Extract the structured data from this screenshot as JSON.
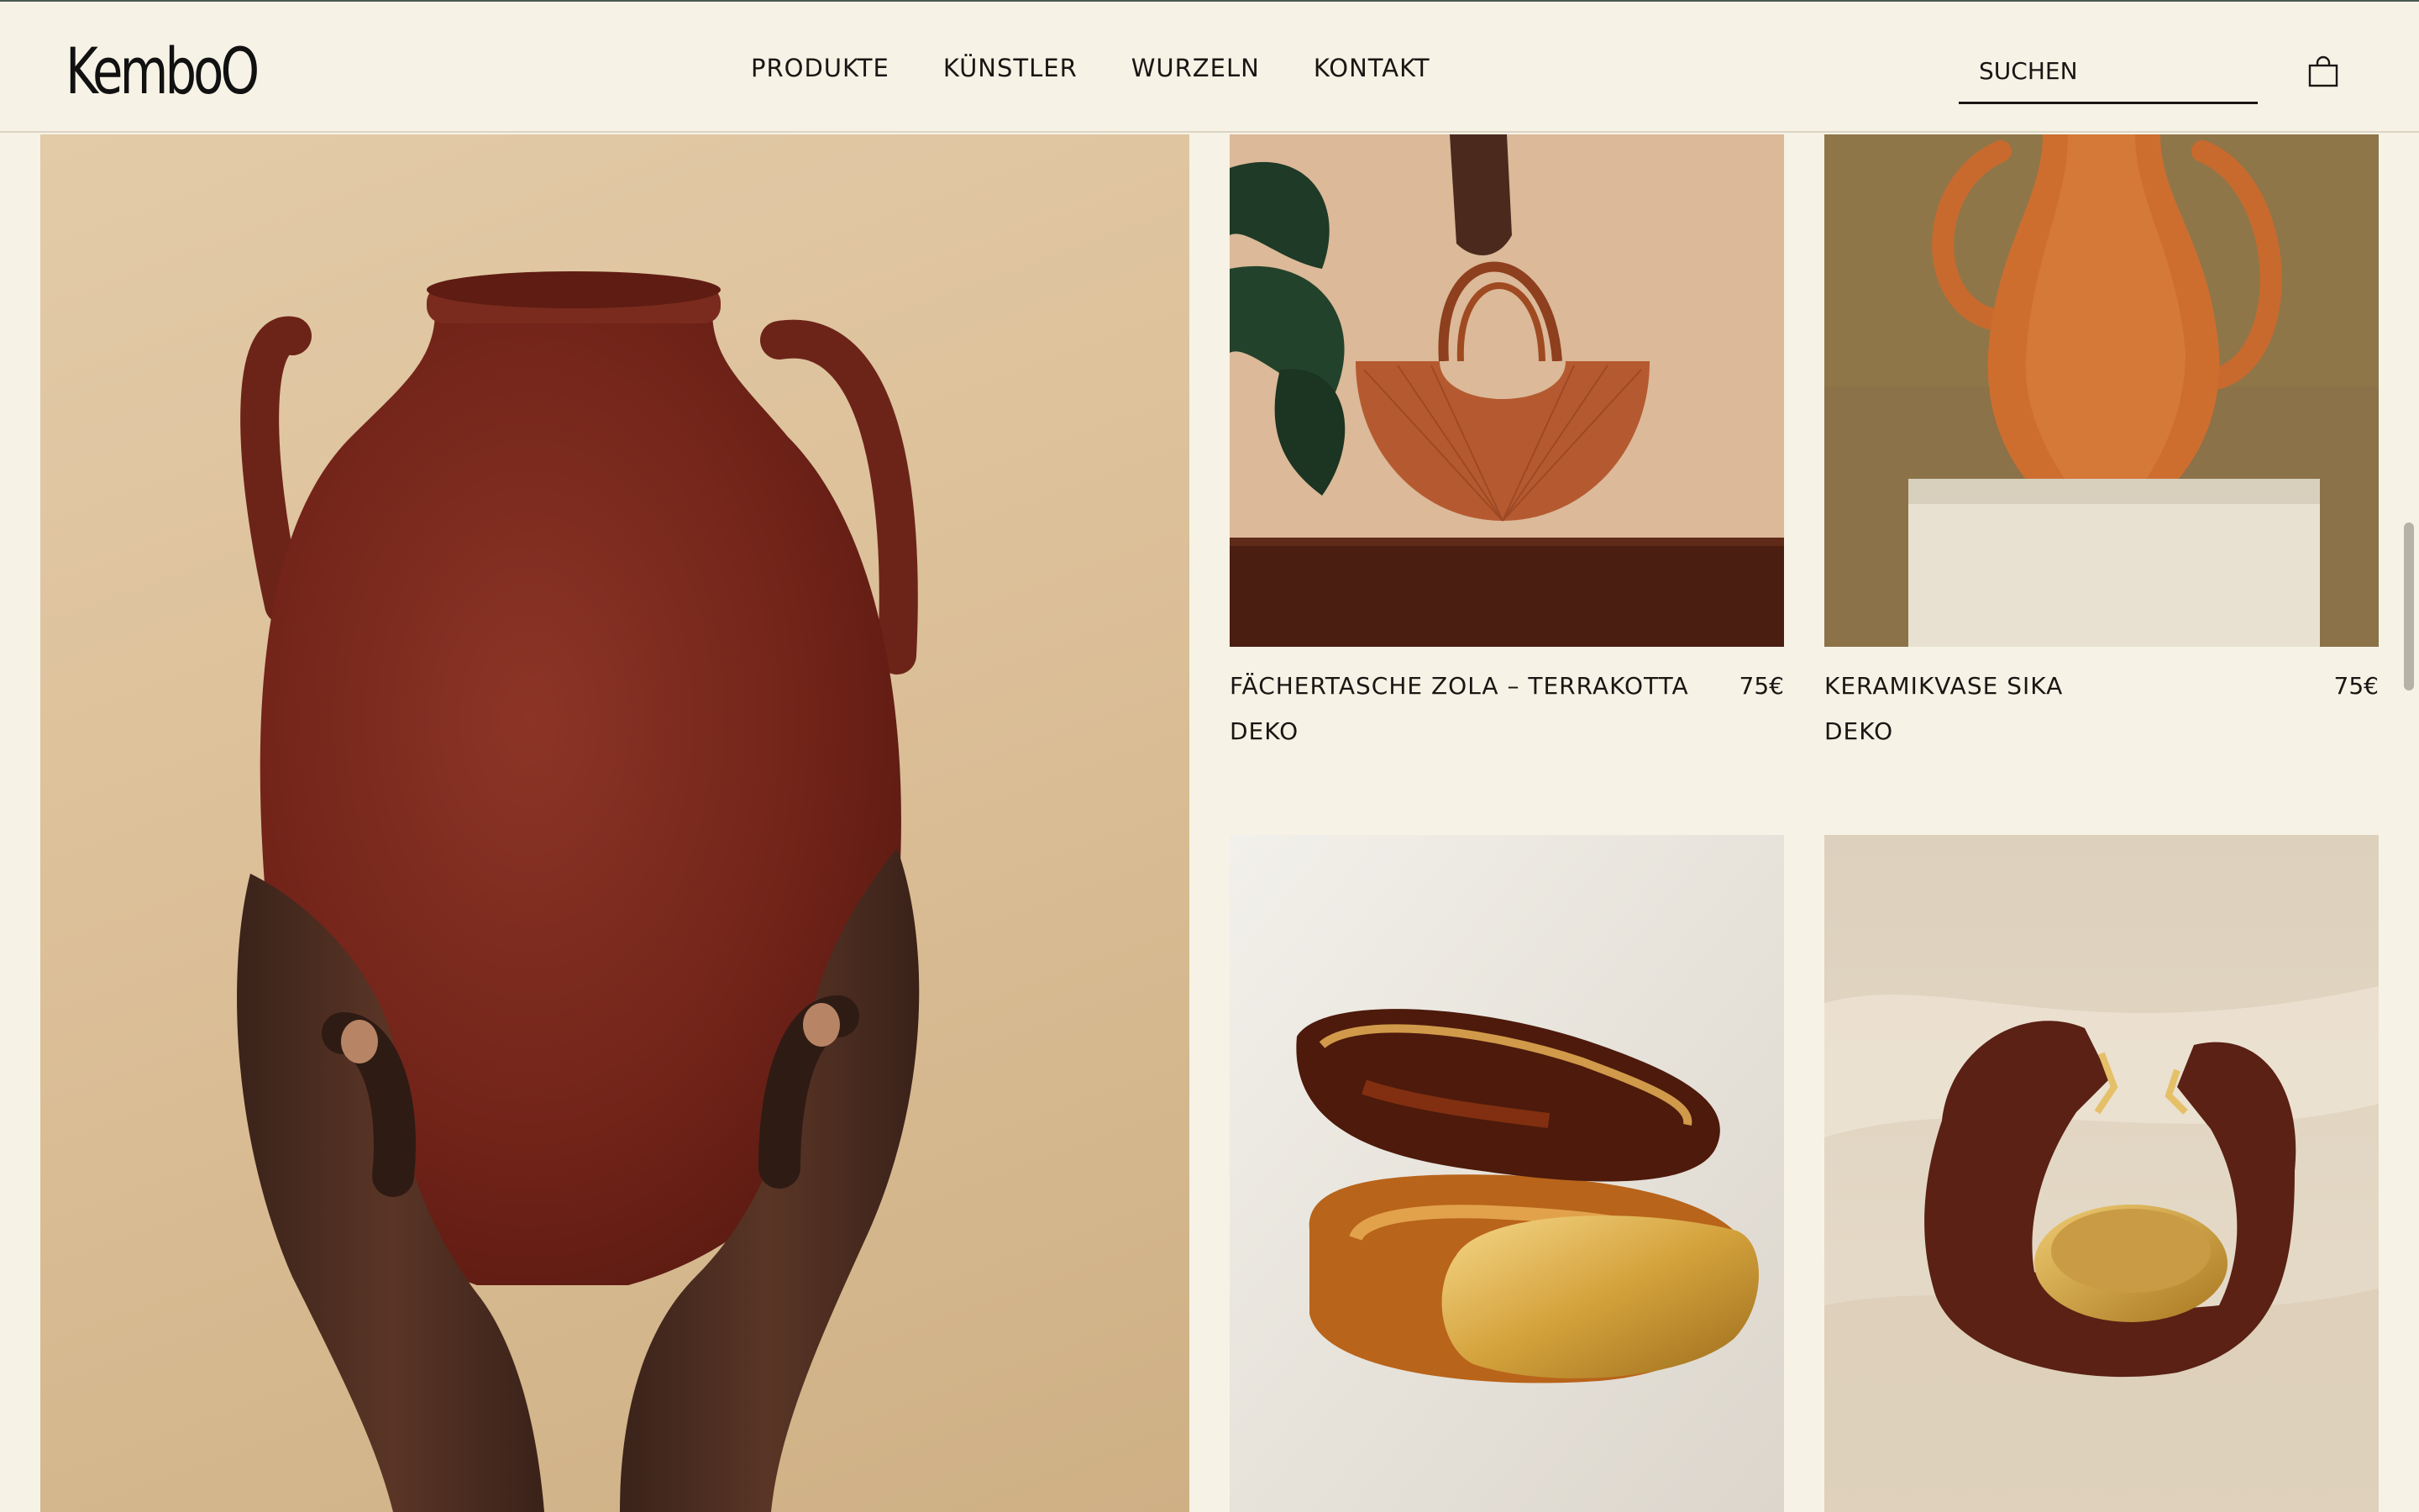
{
  "brand": {
    "logo_text": "KembοO"
  },
  "nav": {
    "items": [
      "PRODUKTE",
      "KÜNSTLER",
      "WURZELN",
      "KONTAKT"
    ]
  },
  "search": {
    "placeholder": "SUCHEN"
  },
  "icons": {
    "cart": "shopping-bag-icon"
  },
  "colors": {
    "background": "#f6f2e6",
    "text": "#1a1613",
    "terracotta": "#b55a30",
    "vase_red": "#7c2a1f"
  },
  "hero": {
    "image": "hands-holding-red-clay-vase"
  },
  "products": [
    {
      "name": "FÄCHERTASCHE ZOLA – TERRAKOTTA",
      "price": "75€",
      "category": "DEKO",
      "image": "woven-terracotta-fan-bag"
    },
    {
      "name": "KERAMIKVASE SIKA",
      "price": "75€",
      "category": "DEKO",
      "image": "terracotta-vase-on-plinth"
    },
    {
      "name": "",
      "price": "",
      "category": "",
      "image": "amber-and-gold-bangles"
    },
    {
      "name": "",
      "price": "",
      "category": "",
      "image": "wooden-gold-cuff-bracelet"
    }
  ]
}
